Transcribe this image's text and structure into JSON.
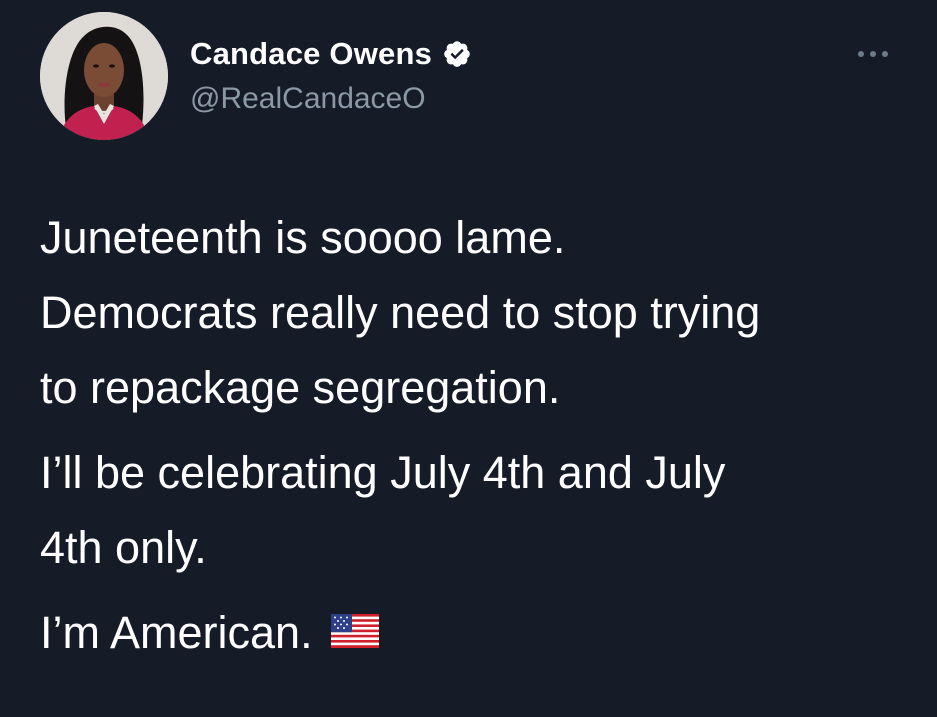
{
  "author": {
    "display_name": "Candace Owens",
    "handle": "@RealCandaceO",
    "verified": true,
    "verified_icon": "verified-badge-icon",
    "avatar": "profile-photo"
  },
  "menu": {
    "more_icon": "more-horizontal-icon"
  },
  "tweet": {
    "line1": "Juneteenth is soooo lame.",
    "line2": "Democrats really need to stop trying",
    "line3": "to repackage segregation.",
    "line4": "I’ll be celebrating July 4th and July",
    "line5": "4th only.",
    "line6": "I’m American.",
    "emoji": "us-flag-emoji"
  },
  "colors": {
    "background": "#151c27",
    "text": "#ffffff",
    "secondary_text": "#8b98a5"
  }
}
